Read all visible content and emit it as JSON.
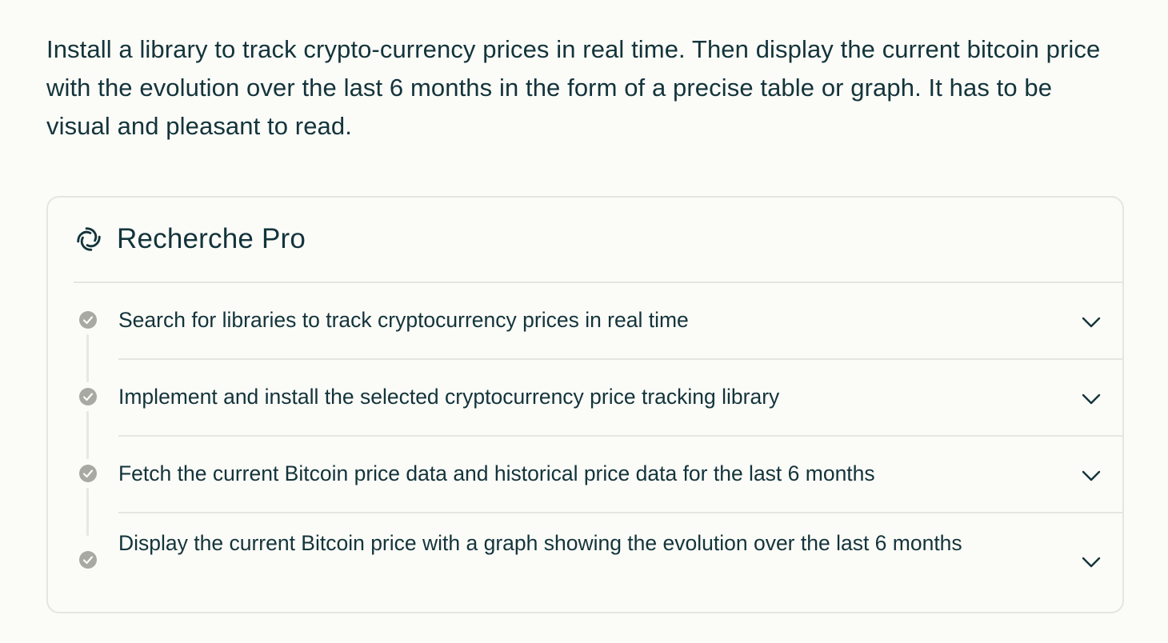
{
  "query": {
    "text": "Install a library to track crypto-currency prices in real time. Then display the current bitcoin price with the evolution over the last 6 months in the form of a precise table or graph. It has to be visual and pleasant to read."
  },
  "card": {
    "title": "Recherche Pro",
    "logo_icon": "perplexity-swirl-logo-icon",
    "steps": [
      {
        "label": "Search for libraries to track cryptocurrency prices in real time",
        "status": "completed",
        "icon": "check-circle-icon"
      },
      {
        "label": "Implement and install the selected cryptocurrency price tracking library",
        "status": "completed",
        "icon": "check-circle-icon"
      },
      {
        "label": "Fetch the current Bitcoin price data and historical price data for the last 6 months",
        "status": "completed",
        "icon": "check-circle-icon"
      },
      {
        "label": "Display the current Bitcoin price with a graph showing the evolution over the last 6 months",
        "status": "completed",
        "icon": "check-circle-icon"
      }
    ]
  },
  "colors": {
    "background": "#fbfbf7",
    "text": "#13343b",
    "border": "#e6e6e0",
    "check": "#a9a9a4"
  }
}
